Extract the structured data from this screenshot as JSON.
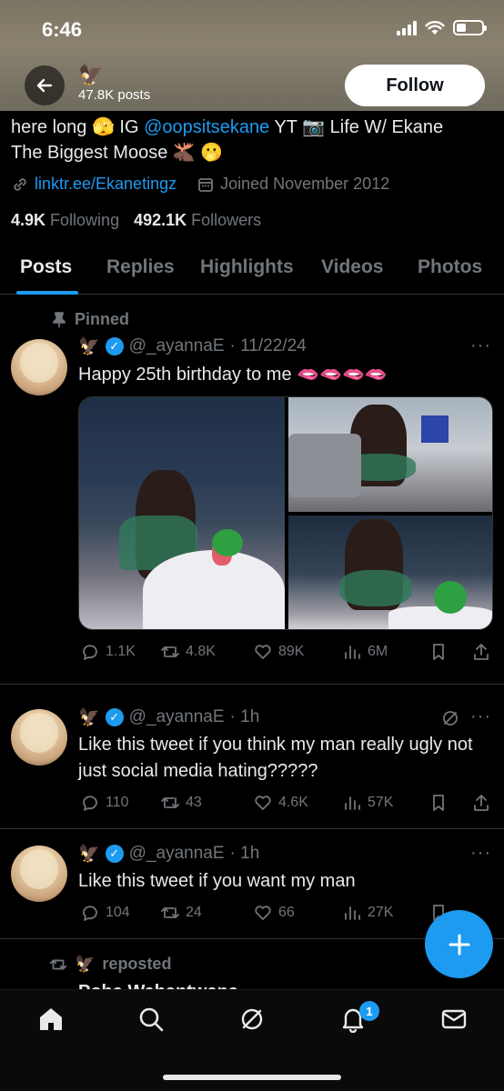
{
  "status_bar": {
    "time": "6:46"
  },
  "header": {
    "avatar_emoji": "🦅",
    "posts_count": "47.8K posts",
    "follow_label": "Follow"
  },
  "profile": {
    "bio_line1_a": "here long 🫣 IG ",
    "bio_mention": "@oopsitsekane",
    "bio_line1_b": " YT 📷 Life W/ Ekane",
    "bio_line2": "The Biggest Moose 🫎 🫢",
    "link": "linktr.ee/Ekanetingz",
    "joined": "Joined November 2012",
    "following_count": "4.9K",
    "following_label": "Following",
    "followers_count": "492.1K",
    "followers_label": "Followers"
  },
  "tabs": [
    "Posts",
    "Replies",
    "Highlights",
    "Videos",
    "Photos"
  ],
  "pinned_label": "Pinned",
  "tweets": [
    {
      "name_emoji": "🦅",
      "handle": "@_ayannaE",
      "time": "· 11/22/24",
      "text": "Happy 25th birthday to me 🫦🫦🫦🫦",
      "replies": "1.1K",
      "reposts": "4.8K",
      "likes": "89K",
      "views": "6M"
    },
    {
      "name_emoji": "🦅",
      "handle": "@_ayannaE",
      "time": "· 1h",
      "text": "Like this tweet if you think my man really ugly not just social media hating?????",
      "replies": "110",
      "reposts": "43",
      "likes": "4.6K",
      "views": "57K"
    },
    {
      "name_emoji": "🦅",
      "handle": "@_ayannaE",
      "time": "· 1h",
      "text": "Like this tweet if you want my man",
      "replies": "104",
      "reposts": "24",
      "likes": "66",
      "views": "27K"
    }
  ],
  "repost": {
    "label": "reposted",
    "next_name": "Poha Wahantwana"
  },
  "notifications_badge": "1",
  "icons": {
    "back": "back-arrow-icon",
    "link": "link-icon",
    "calendar": "calendar-icon",
    "reply": "reply-icon",
    "repost": "repost-icon",
    "like": "heart-icon",
    "views": "views-icon",
    "bookmark": "bookmark-icon",
    "share": "share-icon"
  },
  "colors": {
    "accent": "#1d9bf0",
    "muted": "#71767b",
    "text": "#e7e9ea",
    "bg": "#000000"
  }
}
